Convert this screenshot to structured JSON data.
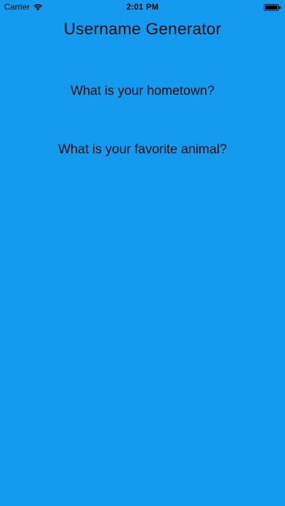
{
  "status_bar": {
    "carrier": "Carrier",
    "time": "2:01 PM",
    "icons": {
      "wifi": "wifi-icon",
      "battery": "battery-icon"
    }
  },
  "app": {
    "title": "Username Generator",
    "questions": [
      {
        "text": "What is your hometown?"
      },
      {
        "text": "What is your favorite animal?"
      }
    ]
  },
  "colors": {
    "background": "#149BEF",
    "text": "#0A0A0A",
    "status_text": "#000000"
  }
}
